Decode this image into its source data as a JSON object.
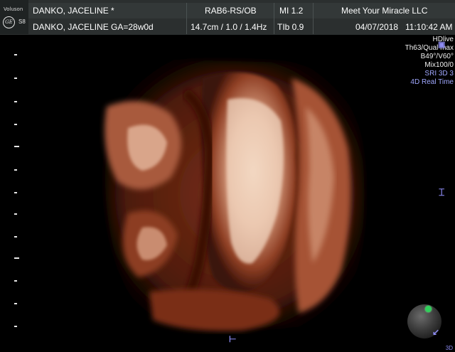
{
  "device": {
    "brand": "Voluson",
    "model": "S8",
    "logo": "GE"
  },
  "patient": {
    "name_id": "DANKO, JACELINE *",
    "name_ga": "DANKO, JACELINE GA=28w0d"
  },
  "probe": {
    "preset": "RAB6-RS/OB",
    "depth_info": "14.7cm / 1.0 / 1.4Hz"
  },
  "indices": {
    "mi": "MI 1.2",
    "tib": "TIb 0.9"
  },
  "facility": {
    "name": "Meet Your Miracle LLC"
  },
  "datetime": {
    "date": "04/07/2018",
    "time": "11:10:42 AM"
  },
  "params": [
    {
      "text": "HDlive",
      "color": "white"
    },
    {
      "text": "Th63/Qual max",
      "color": "white"
    },
    {
      "text": "B49°/V60°",
      "color": "white"
    },
    {
      "text": "Mix100/0",
      "color": "white"
    },
    {
      "text": "SRI 3D 3",
      "color": "blue"
    },
    {
      "text": "4D Real Time",
      "color": "blue"
    }
  ],
  "corner_label": "3D",
  "colors": {
    "accent_blue": "#8d8bf2",
    "header_bg": "#2b2f2f",
    "indicator_green": "#2fd05a"
  }
}
